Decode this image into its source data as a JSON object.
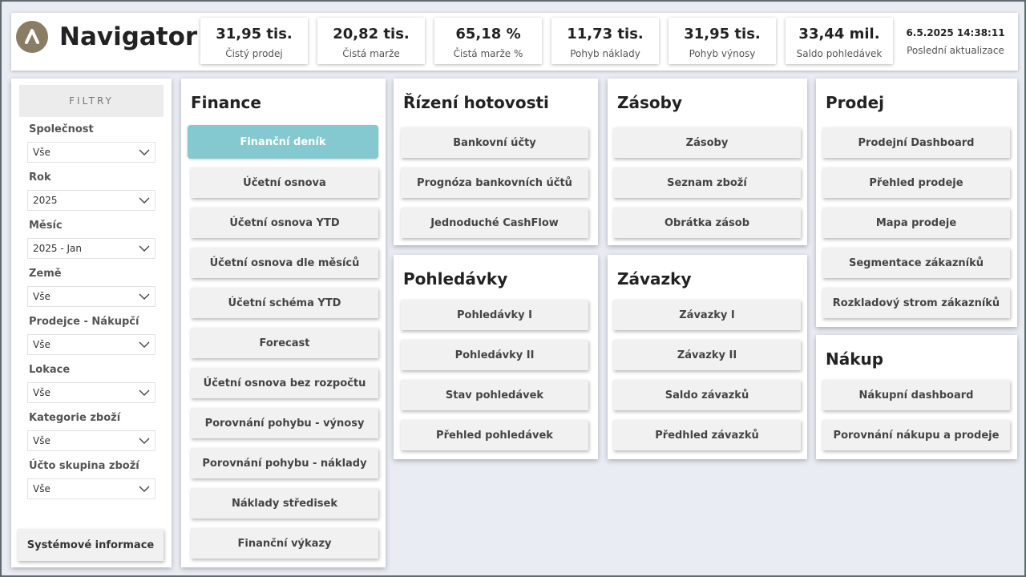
{
  "app": {
    "title": "Navigator"
  },
  "kpis": [
    {
      "value": "31,95 tis.",
      "label": "Čistý prodej"
    },
    {
      "value": "20,82 tis.",
      "label": "Čistá marže"
    },
    {
      "value": "65,18 %",
      "label": "Čistá marže %"
    },
    {
      "value": "11,73 tis.",
      "label": "Pohyb náklady"
    },
    {
      "value": "31,95 tis.",
      "label": "Pohyb výnosy"
    },
    {
      "value": "33,44 mil.",
      "label": "Saldo pohledávek"
    }
  ],
  "last_update": {
    "time": "6.5.2025 14:38:11",
    "label": "Poslední aktualizace"
  },
  "filters": {
    "title": "FILTRY",
    "items": [
      {
        "label": "Společnost",
        "value": "Vše"
      },
      {
        "label": "Rok",
        "value": "2025"
      },
      {
        "label": "Měsíc",
        "value": "2025 - Jan"
      },
      {
        "label": "Země",
        "value": "Vše"
      },
      {
        "label": "Prodejce - Nákupčí",
        "value": "Vše"
      },
      {
        "label": "Lokace",
        "value": "Vše"
      },
      {
        "label": "Kategorie zboží",
        "value": "Vše"
      },
      {
        "label": "Účto skupina zboží",
        "value": "Vše"
      }
    ],
    "system_button": "Systémové informace"
  },
  "finance": {
    "title": "Finance",
    "buttons": [
      "Finanční deník",
      "Účetní osnova",
      "Účetní osnova YTD",
      "Účetní osnova dle měsíců",
      "Účetní schéma YTD",
      "Forecast",
      "Účetní osnova bez rozpočtu",
      "Porovnání pohybu - výnosy",
      "Porovnání pohybu - náklady",
      "Náklady středisek",
      "Finanční výkazy"
    ]
  },
  "cash": {
    "title": "Řízení hotovosti",
    "buttons": [
      "Bankovní účty",
      "Prognóza bankovních účtů",
      "Jednoduché CashFlow"
    ]
  },
  "receivables": {
    "title": "Pohledávky",
    "buttons": [
      "Pohledávky I",
      "Pohledávky II",
      "Stav pohledávek",
      "Přehled pohledávek"
    ]
  },
  "inventory": {
    "title": "Zásoby",
    "buttons": [
      "Zásoby",
      "Seznam zboží",
      "Obrátka zásob"
    ]
  },
  "payables": {
    "title": "Závazky",
    "buttons": [
      "Závazky I",
      "Závazky II",
      "Saldo závazků",
      "Předhled závazků"
    ]
  },
  "sales": {
    "title": "Prodej",
    "buttons": [
      "Prodejní Dashboard",
      "Přehled prodeje",
      "Mapa prodeje",
      "Segmentace zákazníků",
      "Rozkladový strom zákazníků"
    ]
  },
  "purchase": {
    "title": "Nákup",
    "buttons": [
      "Nákupní dashboard",
      "Porovnání nákupu a prodeje"
    ]
  },
  "colors": {
    "active_button": "#84c9d0",
    "logo": "#8b7d64",
    "background": "#e9edf3"
  }
}
